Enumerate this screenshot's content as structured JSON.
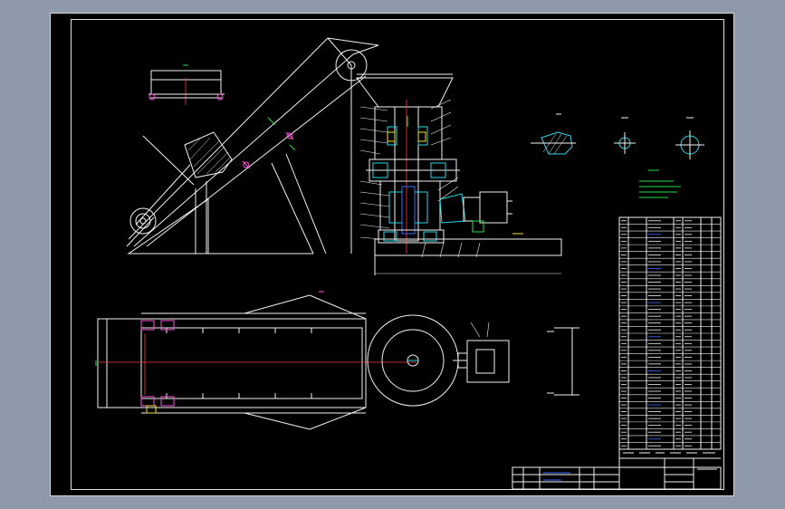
{
  "drawing": {
    "background": "#000000",
    "frame_color": "#e0e0e0",
    "line_colors": {
      "outline": "#f2f2f2",
      "green": "#22e04a",
      "cyan": "#28d7e8",
      "red": "#ff3a3a",
      "magenta": "#ff4fe0",
      "blue": "#3d6bff",
      "yellow": "#f4e32a"
    }
  },
  "views": {
    "side_elevation": "conveyor-side-view",
    "crusher_section": "crusher-sectional-view",
    "plan_view": "conveyor-plan-view",
    "detail_views": [
      "detail-view-1",
      "detail-view-2",
      "detail-view-3"
    ],
    "parts_table": "parts-list-table",
    "title_block": "title-block"
  }
}
